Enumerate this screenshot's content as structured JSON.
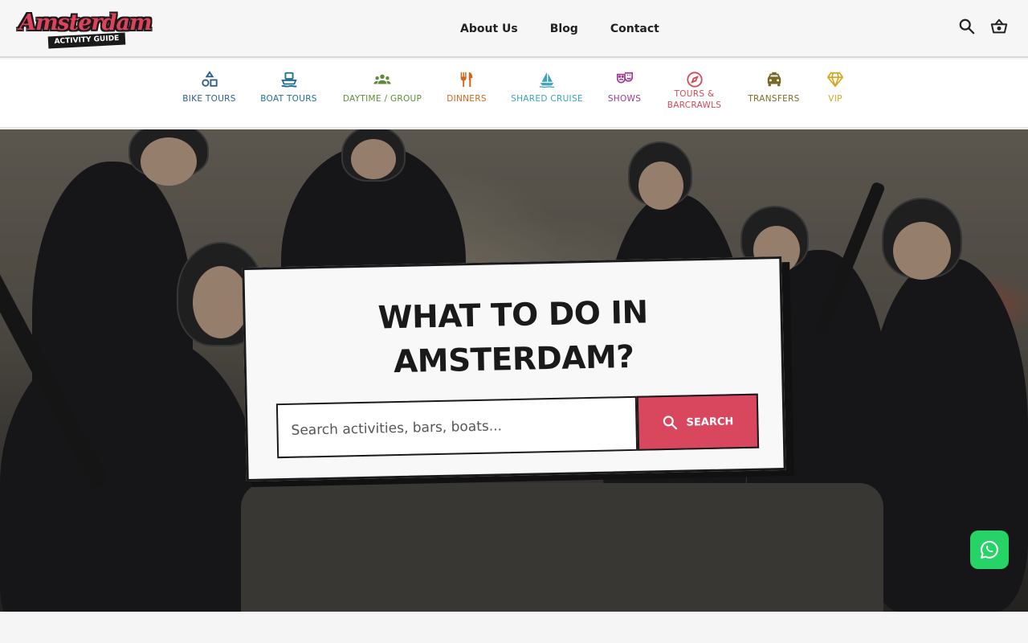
{
  "header": {
    "logo_main": "Amsterdam",
    "logo_sub": "ACTIVITY GUIDE",
    "nav": [
      {
        "label": "About Us"
      },
      {
        "label": "Blog"
      },
      {
        "label": "Contact"
      }
    ],
    "icons": {
      "search": "search-icon",
      "cart": "basket-icon"
    }
  },
  "categories": [
    {
      "label": "BIKE TOURS",
      "color": "#2f5d8a",
      "icon": "shapes-icon"
    },
    {
      "label": "BOAT TOURS",
      "color": "#1f6e92",
      "icon": "ferry-icon"
    },
    {
      "label": "DAYTIME / GROUP",
      "color": "#5e8b3a",
      "icon": "group-icon"
    },
    {
      "label": "DINNERS",
      "color": "#d0661e",
      "icon": "cutlery-icon"
    },
    {
      "label": "SHARED CRUISE",
      "color": "#3aa3b8",
      "icon": "sailboat-icon"
    },
    {
      "label": "SHOWS",
      "color": "#9a3b8c",
      "icon": "theater-masks-icon"
    },
    {
      "label": "TOURS &",
      "label2": "BARCRAWLS",
      "color": "#d24a5a",
      "icon": "compass-icon"
    },
    {
      "label": "TRANSFERS",
      "color": "#7a6a2a",
      "icon": "taxi-icon"
    },
    {
      "label": "VIP",
      "color": "#d4a520",
      "icon": "diamond-icon"
    }
  ],
  "hero": {
    "title_line1": "WHAT TO DO IN",
    "title_line2": "AMSTERDAM?",
    "search_placeholder": "Search activities, bars, boats...",
    "search_button": "SEARCH"
  },
  "colors": {
    "brand": "#e0415a",
    "button": "#d9475f",
    "whatsapp": "#25d366"
  }
}
